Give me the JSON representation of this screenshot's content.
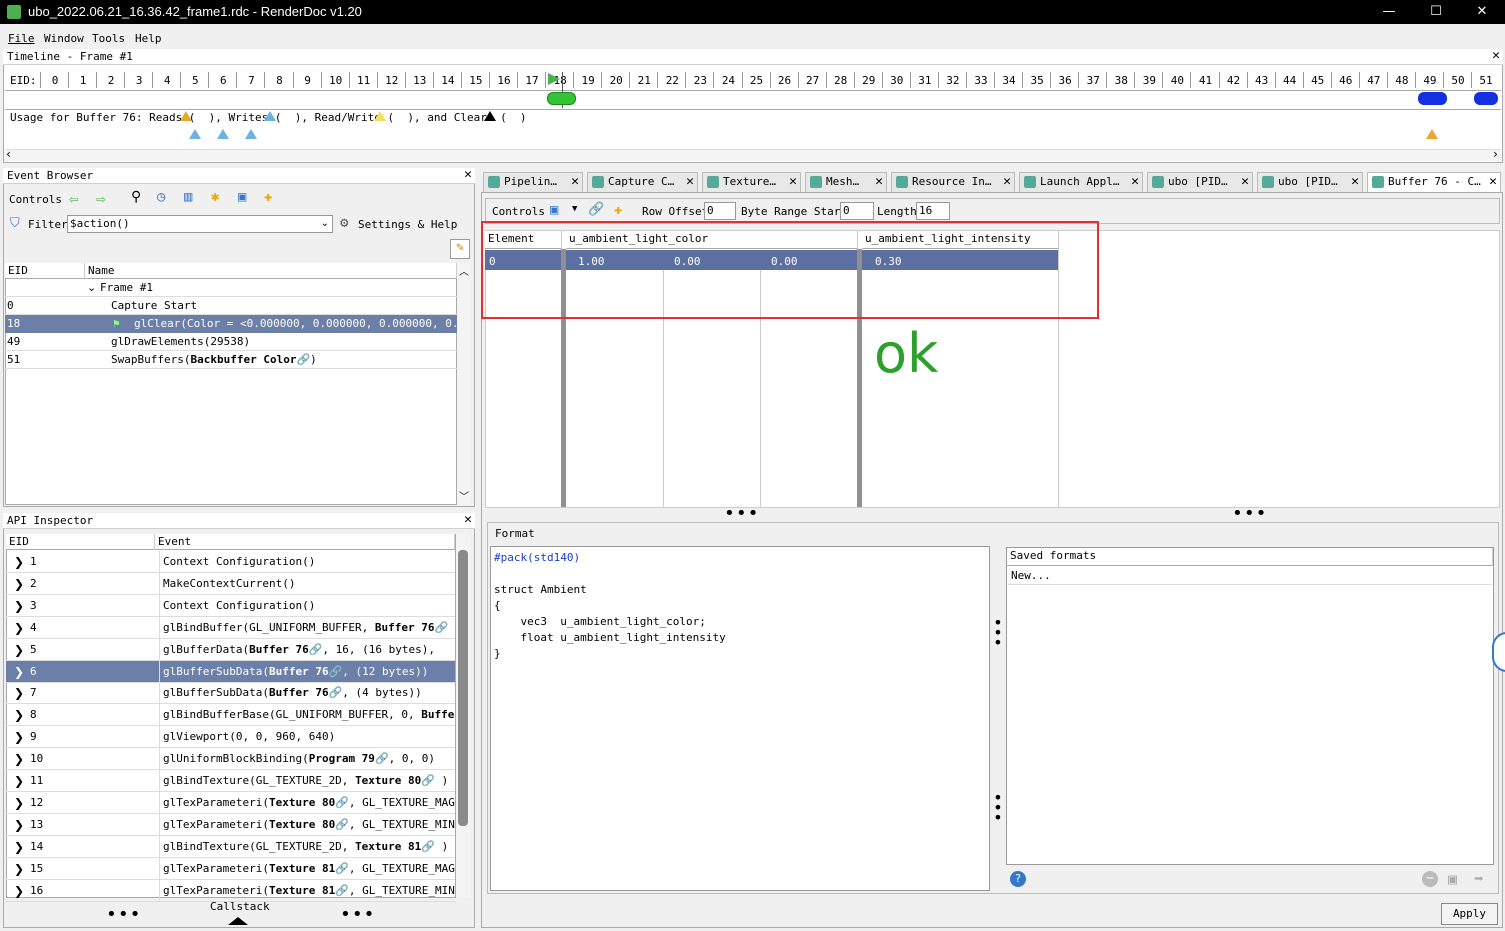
{
  "window": {
    "title": "ubo_2022.06.21_16.36.42_frame1.rdc - RenderDoc v1.20",
    "min": "—",
    "max": "☐",
    "close": "✕"
  },
  "menu": [
    "File",
    "Window",
    "Tools",
    "Help"
  ],
  "timeline": {
    "title": "Timeline - Frame #1",
    "eid_label": "EID:",
    "ticks": [
      "0",
      "1",
      "2",
      "3",
      "4",
      "5",
      "6",
      "7",
      "8",
      "9",
      "10",
      "11",
      "12",
      "13",
      "14",
      "15",
      "16",
      "17",
      "18",
      "19",
      "20",
      "21",
      "22",
      "23",
      "24",
      "25",
      "26",
      "27",
      "28",
      "29",
      "30",
      "31",
      "32",
      "33",
      "34",
      "35",
      "36",
      "37",
      "38",
      "39",
      "40",
      "41",
      "42",
      "43",
      "44",
      "45",
      "46",
      "47",
      "48",
      "49",
      "50",
      "51"
    ],
    "usage": "Usage for Buffer 76: Reads (  ), Writes (  ), Read/Write (  ), and Clears (  )"
  },
  "event_browser": {
    "title": "Event Browser",
    "controls": "Controls",
    "filter_label": "Filter",
    "filter_value": "$action()",
    "settings": "Settings & Help",
    "col_eid": "EID",
    "col_name": "Name",
    "rows": [
      {
        "eid": "",
        "name": "Frame #1"
      },
      {
        "eid": "0",
        "name": "Capture Start"
      },
      {
        "eid": "18",
        "name": "glClear(Color = <0.000000, 0.000000, 0.000000, 0.00…"
      },
      {
        "eid": "49",
        "name": "glDrawElements(29538)"
      },
      {
        "eid": "51",
        "name": "SwapBuffers("
      }
    ],
    "backbuffer": "Backbuffer Color"
  },
  "api_inspector": {
    "title": "API Inspector",
    "col_eid": "EID",
    "col_event": "Event",
    "callstack": "Callstack",
    "rows": [
      {
        "eid": "1",
        "pre": "Context Configuration()",
        "bold": "",
        "post": ""
      },
      {
        "eid": "2",
        "pre": "MakeContextCurrent()",
        "bold": "",
        "post": ""
      },
      {
        "eid": "3",
        "pre": "Context Configuration()",
        "bold": "",
        "post": ""
      },
      {
        "eid": "4",
        "pre": "glBindBuffer(GL_UNIFORM_BUFFER,  ",
        "bold": "Buffer 76",
        "post": " )"
      },
      {
        "eid": "5",
        "pre": "glBufferData(",
        "bold": "Buffer 76",
        "post": ",  16,  (16  bytes),  "
      },
      {
        "eid": "6",
        "pre": "glBufferSubData(",
        "bold": "Buffer 76",
        "post": ",  (12  bytes))"
      },
      {
        "eid": "7",
        "pre": "glBufferSubData(",
        "bold": "Buffer 76",
        "post": ",  (4  bytes))"
      },
      {
        "eid": "8",
        "pre": "glBindBufferBase(GL_UNIFORM_BUFFER,  0,  ",
        "bold": "Buffer",
        "post": ""
      },
      {
        "eid": "9",
        "pre": "glViewport(0,  0,  960,  640)",
        "bold": "",
        "post": ""
      },
      {
        "eid": "10",
        "pre": "glUniformBlockBinding(",
        "bold": "Program 79",
        "post": ",  0,  0)"
      },
      {
        "eid": "11",
        "pre": "glBindTexture(GL_TEXTURE_2D,  ",
        "bold": "Texture 80",
        "post": " )"
      },
      {
        "eid": "12",
        "pre": "glTexParameteri(",
        "bold": "Texture 80",
        "post": ",  GL_TEXTURE_MAG_"
      },
      {
        "eid": "13",
        "pre": "glTexParameteri(",
        "bold": "Texture 80",
        "post": ",  GL_TEXTURE_MIN_"
      },
      {
        "eid": "14",
        "pre": "glBindTexture(GL_TEXTURE_2D,  ",
        "bold": "Texture 81",
        "post": " )"
      },
      {
        "eid": "15",
        "pre": "glTexParameteri(",
        "bold": "Texture 81",
        "post": ",  GL_TEXTURE_MAG_"
      },
      {
        "eid": "16",
        "pre": "glTexParameteri(",
        "bold": "Texture 81",
        "post": ",  GL_TEXTURE_MIN_"
      }
    ]
  },
  "tabs": [
    "Pipelin…",
    "Capture C…",
    "Texture…",
    "Mesh…",
    "Resource In…",
    "Launch Appl…",
    "ubo [PID…",
    "ubo [PID…",
    "Buffer 76 - C…"
  ],
  "buffer_view": {
    "controls": "Controls",
    "row_offset_label": "Row Offset",
    "row_offset": "0",
    "byte_start_label": "Byte Range Start",
    "byte_start": "0",
    "length_label": "Length",
    "length": "16",
    "columns": [
      "Element",
      "u_ambient_light_color",
      "u_ambient_light_intensity"
    ],
    "row": {
      "element": "0",
      "c0": "1.00",
      "c1": "0.00",
      "c2": "0.00",
      "intensity": "0.30"
    },
    "annotation": "ok",
    "annotation_color": "#2ca02c"
  },
  "format": {
    "title": "Format",
    "lines": [
      "#pack(std140)",
      "",
      "struct Ambient",
      "{",
      "    vec3  u_ambient_light_color;",
      "    float u_ambient_light_intensity",
      "}"
    ],
    "saved_title": "Saved formats",
    "saved_new": "New...",
    "apply": "Apply"
  }
}
